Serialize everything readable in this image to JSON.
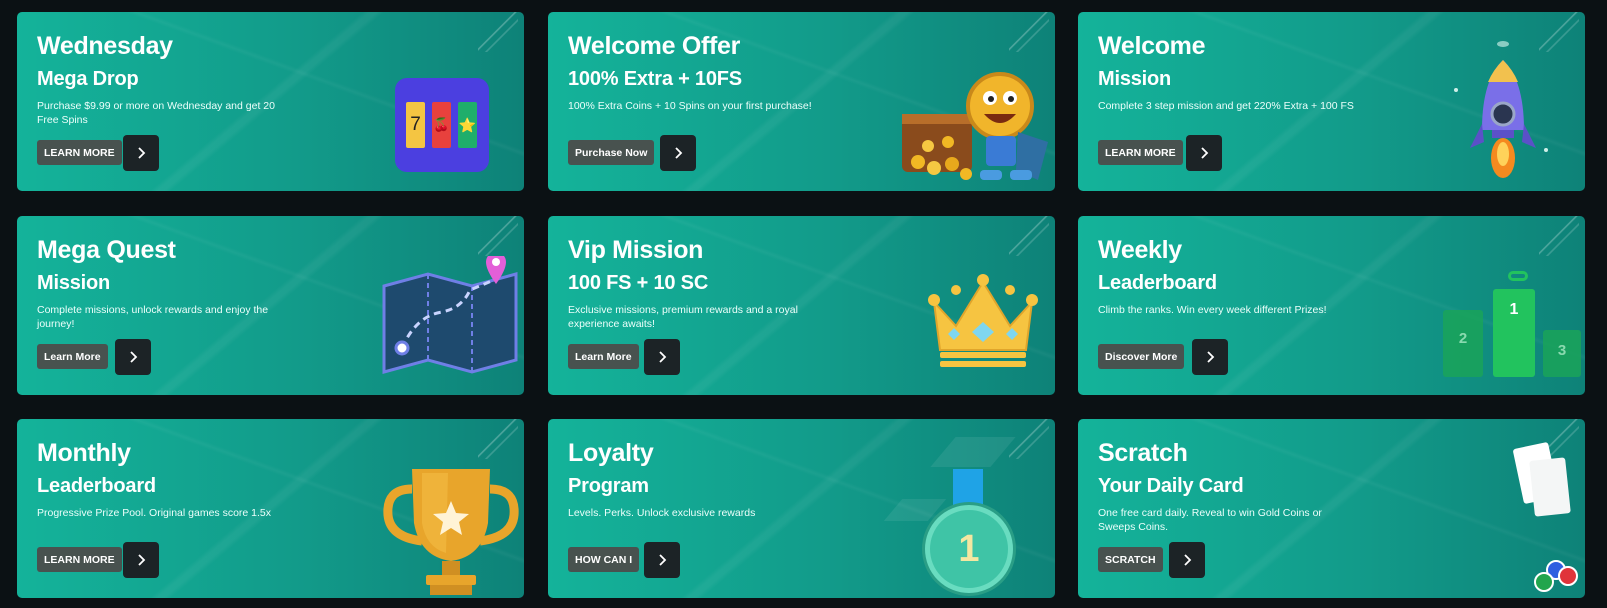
{
  "cards": [
    {
      "title": "Wednesday",
      "subtitle": "Mega Drop",
      "description": "Purchase $9.99 or more on Wednesday and get 20 Free Spins",
      "button": "LEARN MORE",
      "art_icon": "slot-machine-icon"
    },
    {
      "title": "Welcome Offer",
      "subtitle": "100% Extra + 10FS",
      "description": "100% Extra Coins + 10 Spins on your first purchase!",
      "button": "Purchase Now",
      "art_icon": "coin-mascot-chest-icon"
    },
    {
      "title": "Welcome",
      "subtitle": "Mission",
      "description": "Complete 3 step mission and get 220% Extra + 100 FS",
      "button": "LEARN MORE",
      "art_icon": "rocket-icon"
    },
    {
      "title": "Mega Quest",
      "subtitle": "Mission",
      "description": "Complete missions, unlock rewards and enjoy the journey!",
      "button": "Learn More",
      "art_icon": "map-icon"
    },
    {
      "title": "Vip Mission",
      "subtitle": "100 FS + 10 SC",
      "description": "Exclusive missions, premium rewards and a royal experience awaits!",
      "button": "Learn More",
      "art_icon": "crown-icon"
    },
    {
      "title": "Weekly",
      "subtitle": "Leaderboard",
      "description": "Climb the ranks. Win every week different Prizes!",
      "button": "Discover More",
      "art_icon": "podium-icon",
      "podium": [
        "1",
        "2",
        "3"
      ]
    },
    {
      "title": "Monthly",
      "subtitle": "Leaderboard",
      "description": "Progressive Prize Pool. Original games score 1.5x",
      "button": "LEARN MORE",
      "art_icon": "trophy-icon"
    },
    {
      "title": "Loyalty",
      "subtitle": "Program",
      "description": "Levels. Perks. Unlock exclusive rewards",
      "button": "HOW CAN I",
      "art_icon": "medal-icon",
      "medal": "1"
    },
    {
      "title": "Scratch",
      "subtitle": "Your Daily Card",
      "description": "One free card daily. Reveal to win Gold Coins or Sweeps Coins.",
      "button": "SCRATCH",
      "art_icon": "scratch-cards-icon"
    }
  ],
  "slot_symbols": [
    "7",
    "🍒",
    "⭐"
  ],
  "arrow_icon": "chevron-right-icon",
  "colors": {
    "card_start": "#14b39a",
    "card_end": "#0e8278",
    "button_bg": "#48524f",
    "arrow_bg": "#1c2326",
    "page_bg": "#0b1114"
  }
}
